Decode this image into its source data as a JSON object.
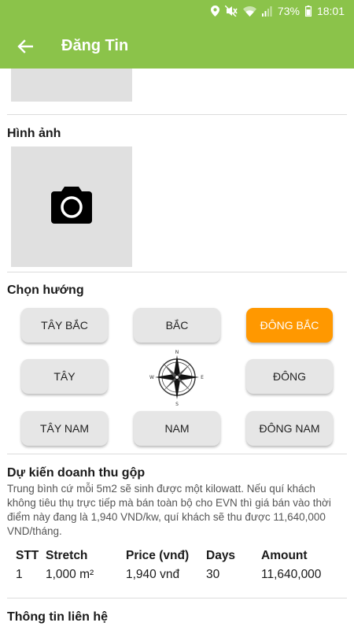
{
  "status_bar": {
    "battery": "73%",
    "time": "18:01"
  },
  "toolbar": {
    "title": "Đăng Tin"
  },
  "images_section": {
    "title": "Hình ảnh"
  },
  "direction_section": {
    "title": "Chọn hướng",
    "buttons": {
      "northwest": "TÂY BẮC",
      "north": "BẮC",
      "northeast": "ĐÔNG BẮC",
      "west": "TÂY",
      "east": "ĐÔNG",
      "southwest": "TÂY NAM",
      "south": "NAM",
      "southeast": "ĐÔNG NAM"
    },
    "selected": "ĐÔNG BẮC",
    "compass_labels": {
      "n": "N",
      "s": "S",
      "e": "E",
      "w": "W"
    },
    "accent_color": "#ff9800"
  },
  "revenue_section": {
    "title": "Dự kiến doanh thu gộp",
    "description": "Trung bình cứ mỗi 5m2 sẽ sinh được một kilowatt. Nếu quí khách không tiêu thụ trực tiếp mà bán toàn bộ cho EVN thì giá bán vào thời điểm này đang là 1,940 VND/kw, quí khách sẽ thu được 11,640,000 VND/tháng.",
    "table": {
      "headers": {
        "stt": "STT",
        "stretch": "Stretch",
        "price": "Price (vnđ)",
        "days": "Days",
        "amount": "Amount"
      },
      "rows": [
        {
          "stt": "1",
          "stretch": "1,000 m²",
          "price": "1,940 vnđ",
          "days": "30",
          "amount": "11,640,000"
        }
      ]
    }
  },
  "contact_section": {
    "title": "Thông tin liên hệ"
  },
  "theme": {
    "primary": "#8bc34a",
    "button_bg": "#e6e6e6",
    "placeholder_bg": "#e0e0e0"
  }
}
